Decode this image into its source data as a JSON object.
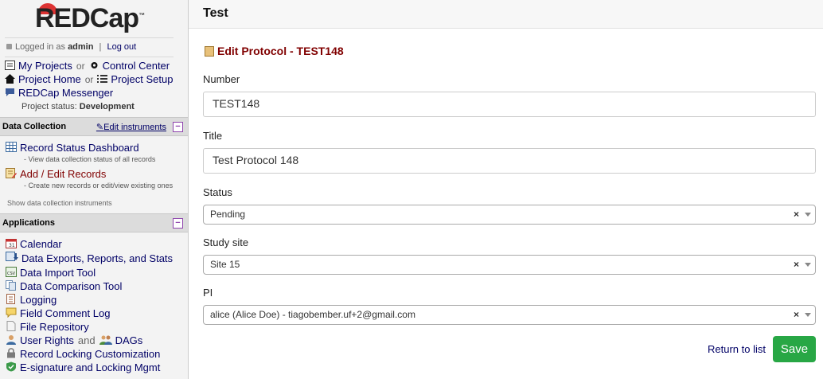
{
  "logo": {
    "text": "REDCap",
    "tm": "™"
  },
  "login": {
    "prefix": "Logged in as",
    "user": "admin",
    "sep": "|",
    "logout": "Log out"
  },
  "nav": {
    "my_projects": "My Projects",
    "or": "or",
    "control_center": "Control Center",
    "project_home": "Project Home",
    "project_setup": "Project Setup",
    "messenger": "REDCap Messenger",
    "status_label": "Project status:",
    "status_value": "Development"
  },
  "data_collection": {
    "header": "Data Collection",
    "edit_instruments": "Edit instruments",
    "items": [
      {
        "label": "Record Status Dashboard",
        "desc": "- View data collection status of all records"
      },
      {
        "label": "Add / Edit Records",
        "desc": "- Create new records or edit/view existing ones"
      }
    ],
    "show_instruments": "Show data collection instruments"
  },
  "applications": {
    "header": "Applications",
    "items": [
      "Calendar",
      "Data Exports, Reports, and Stats",
      "Data Import Tool",
      "Data Comparison Tool",
      "Logging",
      "Field Comment Log",
      "File Repository"
    ],
    "user_rights": "User Rights",
    "and": "and",
    "dags": "DAGs",
    "record_locking": "Record Locking Customization",
    "esignature": "E-signature and Locking Mgmt"
  },
  "page": {
    "title": "Test",
    "form_title": "Edit Protocol - TEST148"
  },
  "form": {
    "number_label": "Number",
    "number_value": "TEST148",
    "title_label": "Title",
    "title_value": "Test Protocol 148",
    "status_label": "Status",
    "status_value": "Pending",
    "site_label": "Study site",
    "site_value": "Site 15",
    "pi_label": "PI",
    "pi_value": "alice (Alice Doe) - tiagobember.uf+2@gmail.com",
    "clear_glyph": "×"
  },
  "actions": {
    "return": "Return to list",
    "save": "Save"
  },
  "colors": {
    "link": "#000066",
    "accent_red": "#800000",
    "save_green": "#28a745",
    "minus_purple": "#8e44ad"
  }
}
